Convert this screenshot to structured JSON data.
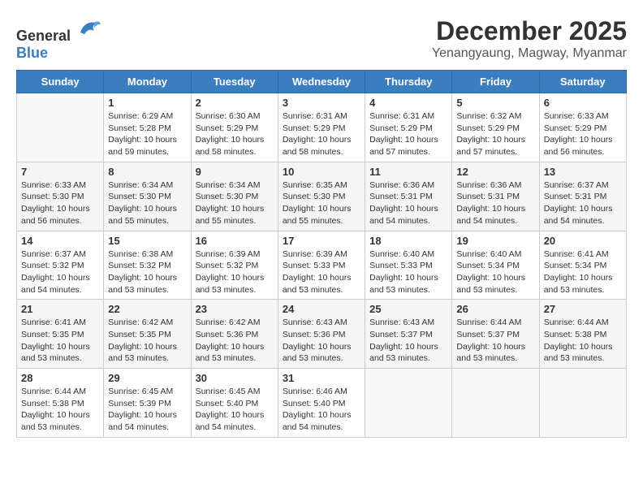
{
  "header": {
    "logo_general": "General",
    "logo_blue": "Blue",
    "month_title": "December 2025",
    "location": "Yenangyaung, Magway, Myanmar"
  },
  "weekdays": [
    "Sunday",
    "Monday",
    "Tuesday",
    "Wednesday",
    "Thursday",
    "Friday",
    "Saturday"
  ],
  "weeks": [
    [
      {
        "day": "",
        "info": ""
      },
      {
        "day": "1",
        "info": "Sunrise: 6:29 AM\nSunset: 5:28 PM\nDaylight: 10 hours\nand 59 minutes."
      },
      {
        "day": "2",
        "info": "Sunrise: 6:30 AM\nSunset: 5:29 PM\nDaylight: 10 hours\nand 58 minutes."
      },
      {
        "day": "3",
        "info": "Sunrise: 6:31 AM\nSunset: 5:29 PM\nDaylight: 10 hours\nand 58 minutes."
      },
      {
        "day": "4",
        "info": "Sunrise: 6:31 AM\nSunset: 5:29 PM\nDaylight: 10 hours\nand 57 minutes."
      },
      {
        "day": "5",
        "info": "Sunrise: 6:32 AM\nSunset: 5:29 PM\nDaylight: 10 hours\nand 57 minutes."
      },
      {
        "day": "6",
        "info": "Sunrise: 6:33 AM\nSunset: 5:29 PM\nDaylight: 10 hours\nand 56 minutes."
      }
    ],
    [
      {
        "day": "7",
        "info": "Sunrise: 6:33 AM\nSunset: 5:30 PM\nDaylight: 10 hours\nand 56 minutes."
      },
      {
        "day": "8",
        "info": "Sunrise: 6:34 AM\nSunset: 5:30 PM\nDaylight: 10 hours\nand 55 minutes."
      },
      {
        "day": "9",
        "info": "Sunrise: 6:34 AM\nSunset: 5:30 PM\nDaylight: 10 hours\nand 55 minutes."
      },
      {
        "day": "10",
        "info": "Sunrise: 6:35 AM\nSunset: 5:30 PM\nDaylight: 10 hours\nand 55 minutes."
      },
      {
        "day": "11",
        "info": "Sunrise: 6:36 AM\nSunset: 5:31 PM\nDaylight: 10 hours\nand 54 minutes."
      },
      {
        "day": "12",
        "info": "Sunrise: 6:36 AM\nSunset: 5:31 PM\nDaylight: 10 hours\nand 54 minutes."
      },
      {
        "day": "13",
        "info": "Sunrise: 6:37 AM\nSunset: 5:31 PM\nDaylight: 10 hours\nand 54 minutes."
      }
    ],
    [
      {
        "day": "14",
        "info": "Sunrise: 6:37 AM\nSunset: 5:32 PM\nDaylight: 10 hours\nand 54 minutes."
      },
      {
        "day": "15",
        "info": "Sunrise: 6:38 AM\nSunset: 5:32 PM\nDaylight: 10 hours\nand 53 minutes."
      },
      {
        "day": "16",
        "info": "Sunrise: 6:39 AM\nSunset: 5:32 PM\nDaylight: 10 hours\nand 53 minutes."
      },
      {
        "day": "17",
        "info": "Sunrise: 6:39 AM\nSunset: 5:33 PM\nDaylight: 10 hours\nand 53 minutes."
      },
      {
        "day": "18",
        "info": "Sunrise: 6:40 AM\nSunset: 5:33 PM\nDaylight: 10 hours\nand 53 minutes."
      },
      {
        "day": "19",
        "info": "Sunrise: 6:40 AM\nSunset: 5:34 PM\nDaylight: 10 hours\nand 53 minutes."
      },
      {
        "day": "20",
        "info": "Sunrise: 6:41 AM\nSunset: 5:34 PM\nDaylight: 10 hours\nand 53 minutes."
      }
    ],
    [
      {
        "day": "21",
        "info": "Sunrise: 6:41 AM\nSunset: 5:35 PM\nDaylight: 10 hours\nand 53 minutes."
      },
      {
        "day": "22",
        "info": "Sunrise: 6:42 AM\nSunset: 5:35 PM\nDaylight: 10 hours\nand 53 minutes."
      },
      {
        "day": "23",
        "info": "Sunrise: 6:42 AM\nSunset: 5:36 PM\nDaylight: 10 hours\nand 53 minutes."
      },
      {
        "day": "24",
        "info": "Sunrise: 6:43 AM\nSunset: 5:36 PM\nDaylight: 10 hours\nand 53 minutes."
      },
      {
        "day": "25",
        "info": "Sunrise: 6:43 AM\nSunset: 5:37 PM\nDaylight: 10 hours\nand 53 minutes."
      },
      {
        "day": "26",
        "info": "Sunrise: 6:44 AM\nSunset: 5:37 PM\nDaylight: 10 hours\nand 53 minutes."
      },
      {
        "day": "27",
        "info": "Sunrise: 6:44 AM\nSunset: 5:38 PM\nDaylight: 10 hours\nand 53 minutes."
      }
    ],
    [
      {
        "day": "28",
        "info": "Sunrise: 6:44 AM\nSunset: 5:38 PM\nDaylight: 10 hours\nand 53 minutes."
      },
      {
        "day": "29",
        "info": "Sunrise: 6:45 AM\nSunset: 5:39 PM\nDaylight: 10 hours\nand 54 minutes."
      },
      {
        "day": "30",
        "info": "Sunrise: 6:45 AM\nSunset: 5:40 PM\nDaylight: 10 hours\nand 54 minutes."
      },
      {
        "day": "31",
        "info": "Sunrise: 6:46 AM\nSunset: 5:40 PM\nDaylight: 10 hours\nand 54 minutes."
      },
      {
        "day": "",
        "info": ""
      },
      {
        "day": "",
        "info": ""
      },
      {
        "day": "",
        "info": ""
      }
    ]
  ]
}
